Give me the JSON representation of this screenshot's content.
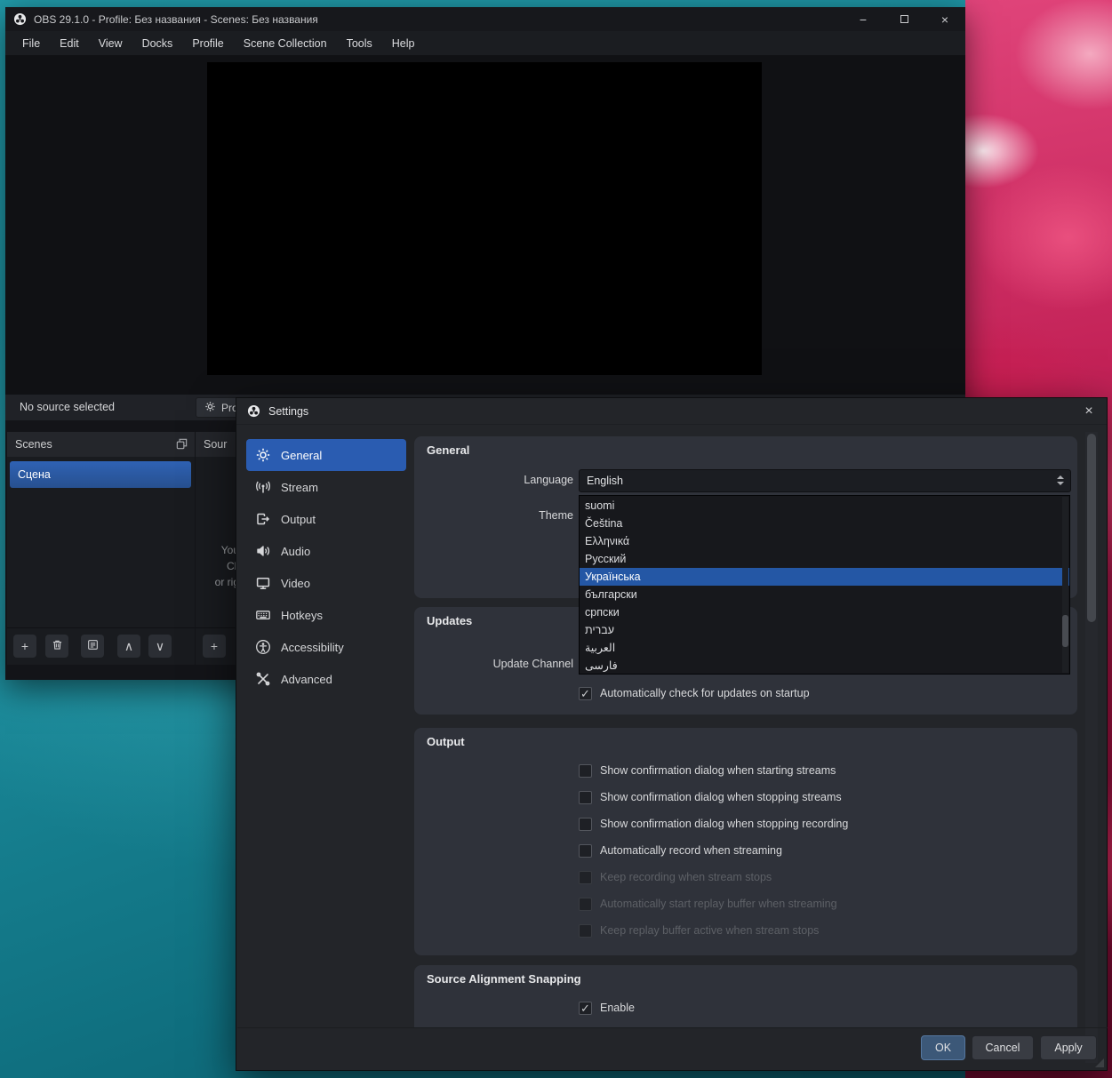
{
  "icons": {
    "minimize": "−",
    "close": "×",
    "check": "✓",
    "plus": "+",
    "up": "∧",
    "down": "∨"
  },
  "colors": {
    "accent_blue": "#2a5cb1",
    "selection_blue": "#2457a5",
    "desktop_teal": "#1b8c9c",
    "flower_pink": "#c32257"
  },
  "obs": {
    "title": "OBS 29.1.0 - Profile: Без названия - Scenes: Без названия",
    "menus": [
      "File",
      "Edit",
      "View",
      "Docks",
      "Profile",
      "Scene Collection",
      "Tools",
      "Help"
    ],
    "context_bar": {
      "status": "No source selected",
      "properties_button": "Pro"
    },
    "scenes": {
      "header": "Scenes",
      "items": [
        "Сцена"
      ]
    },
    "sources": {
      "header": "Sour",
      "empty_lines": [
        "You",
        "Cli",
        "or rig"
      ]
    }
  },
  "settings": {
    "title": "Settings",
    "sidebar": [
      {
        "label": "General",
        "icon": "gear",
        "selected": true
      },
      {
        "label": "Stream",
        "icon": "antenna",
        "selected": false
      },
      {
        "label": "Output",
        "icon": "export",
        "selected": false
      },
      {
        "label": "Audio",
        "icon": "speaker",
        "selected": false
      },
      {
        "label": "Video",
        "icon": "monitor",
        "selected": false
      },
      {
        "label": "Hotkeys",
        "icon": "keyboard",
        "selected": false
      },
      {
        "label": "Accessibility",
        "icon": "accessibility",
        "selected": false
      },
      {
        "label": "Advanced",
        "icon": "crossed-tools",
        "selected": false
      }
    ],
    "general": {
      "title": "General",
      "language_label": "Language",
      "language_value": "English",
      "theme_label": "Theme"
    },
    "language_dropdown": {
      "options": [
        "suomi",
        "Čeština",
        "Ελληνικά",
        "Русский",
        "Українська",
        "български",
        "српски",
        "עברית",
        "العربية",
        "فارسی"
      ],
      "highlighted": "Українська"
    },
    "updates": {
      "title": "Updates",
      "channel_label": "Update Channel",
      "auto_check_label": "Automatically check for updates on startup",
      "auto_check_checked": true
    },
    "output": {
      "title": "Output",
      "options": [
        {
          "label": "Show confirmation dialog when starting streams",
          "checked": false,
          "disabled": false
        },
        {
          "label": "Show confirmation dialog when stopping streams",
          "checked": false,
          "disabled": false
        },
        {
          "label": "Show confirmation dialog when stopping recording",
          "checked": false,
          "disabled": false
        },
        {
          "label": "Automatically record when streaming",
          "checked": false,
          "disabled": false
        },
        {
          "label": "Keep recording when stream stops",
          "checked": false,
          "disabled": true
        },
        {
          "label": "Automatically start replay buffer when streaming",
          "checked": false,
          "disabled": true
        },
        {
          "label": "Keep replay buffer active when stream stops",
          "checked": false,
          "disabled": true
        }
      ]
    },
    "snapping": {
      "title": "Source Alignment Snapping",
      "enable_label": "Enable",
      "enable_checked": true
    },
    "buttons": {
      "ok": "OK",
      "cancel": "Cancel",
      "apply": "Apply"
    }
  }
}
